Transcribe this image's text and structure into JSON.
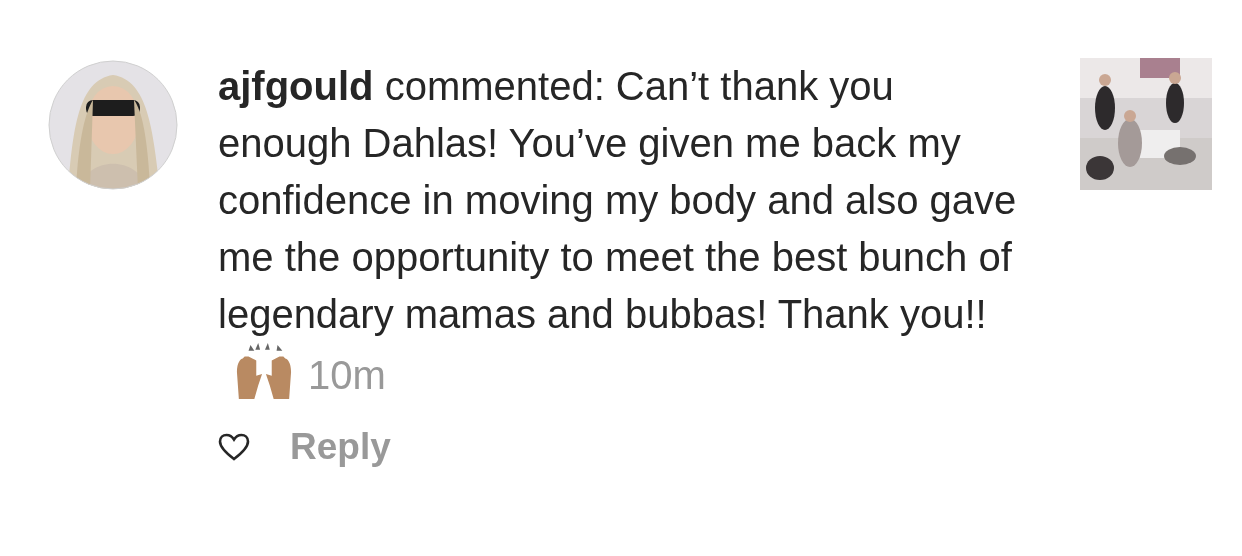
{
  "comment": {
    "text": "**ajfgould** commented: Can’t thank you enough Dahlas! You’ve given me back my confidence in moving my body and also gave me the opportunity to meet the best bunch of legendary mamas and bubbas! Thank you!!",
    "time": "10m",
    "liked": false,
    "reply": "Reply"
  }
}
